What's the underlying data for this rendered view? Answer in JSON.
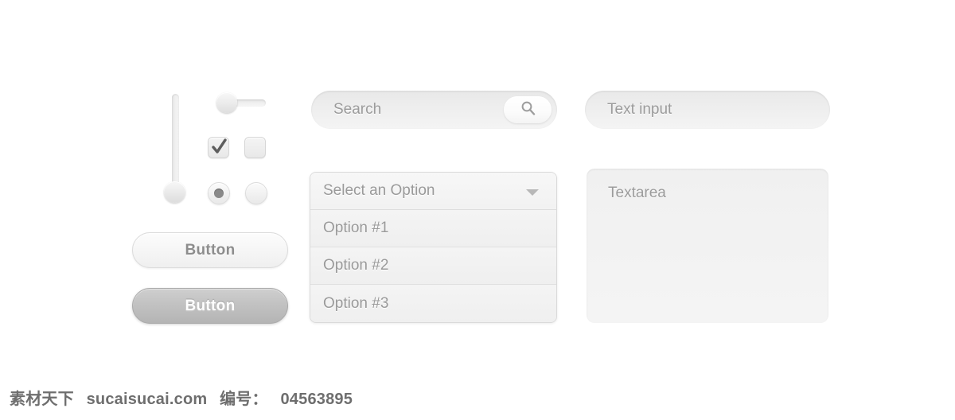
{
  "background_color": "#ffffff",
  "controls": {
    "vertical_slider": {
      "name": "vertical-slider",
      "orientation": "vertical",
      "knob_position": "bottom"
    },
    "horizontal_slider": {
      "name": "horizontal-slider",
      "orientation": "horizontal",
      "knob_position": "left"
    },
    "checkboxes": [
      {
        "label": "",
        "checked": true,
        "icon": "check-icon"
      },
      {
        "label": "",
        "checked": false,
        "icon": ""
      }
    ],
    "radios": [
      {
        "label": "",
        "checked": true
      },
      {
        "label": "",
        "checked": false
      }
    ],
    "buttons": [
      {
        "label": "Button",
        "style": "light",
        "text_color": "#8d8d8d"
      },
      {
        "label": "Button",
        "style": "dark",
        "text_color": "#ffffff"
      }
    ]
  },
  "search": {
    "value": "Search",
    "placeholder": "Search",
    "icon": "search-icon",
    "button_label": ""
  },
  "select": {
    "selected_label": "Select an Option",
    "caret_icon": "chevron-down-icon",
    "options": [
      {
        "label": "Option #1"
      },
      {
        "label": "Option #2"
      },
      {
        "label": "Option #3"
      }
    ]
  },
  "text_input": {
    "value": "Text input",
    "placeholder": "Text input"
  },
  "textarea": {
    "value": "Textarea",
    "placeholder": "Textarea"
  },
  "watermark": {
    "site_cn": "素材天下",
    "site_url": "sucaisucai.com",
    "id_label": "编号：",
    "id_value": "04563895"
  }
}
